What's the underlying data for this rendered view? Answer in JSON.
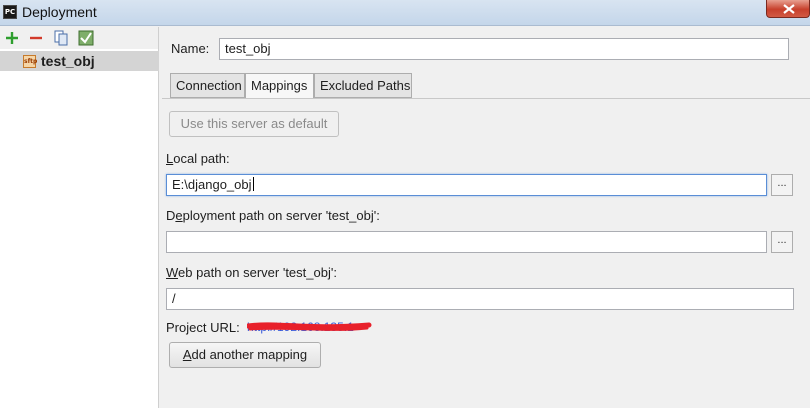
{
  "window": {
    "title": "Deployment",
    "app_icon_text": "PC"
  },
  "left_panel": {
    "toolbar": [
      "add-icon",
      "remove-icon",
      "copy-icon",
      "check-icon"
    ],
    "servers": [
      {
        "name": "test_obj",
        "type_icon": "sftp"
      }
    ]
  },
  "form": {
    "name_label": "Name:",
    "name_value": "test_obj"
  },
  "tabs": [
    {
      "label": "Connection",
      "active": false
    },
    {
      "label": "Mappings",
      "active": true
    },
    {
      "label": "Excluded Paths",
      "active": false
    }
  ],
  "mappings": {
    "default_button": "Use this server as default",
    "local_path_label_first": "L",
    "local_path_label_rest": "ocal path:",
    "local_path_value": "E:\\django_obj",
    "deploy_path_label_prefix": "D",
    "deploy_path_label_mid": "e",
    "deploy_path_label_rest": "ployment path on server 'test_obj':",
    "deploy_path_value": "",
    "web_path_label_first": "W",
    "web_path_label_rest": "eb path on server 'test_obj':",
    "web_path_value": "/",
    "project_url_label": "Project URL:",
    "project_url_value": "http://192.168.135.1",
    "browse_label": "...",
    "add_mapping_first": "A",
    "add_mapping_rest": "dd another mapping"
  },
  "colors": {
    "redaction": "#e8202a",
    "link": "#3a5bd9",
    "selection": "#d4d4d4"
  }
}
